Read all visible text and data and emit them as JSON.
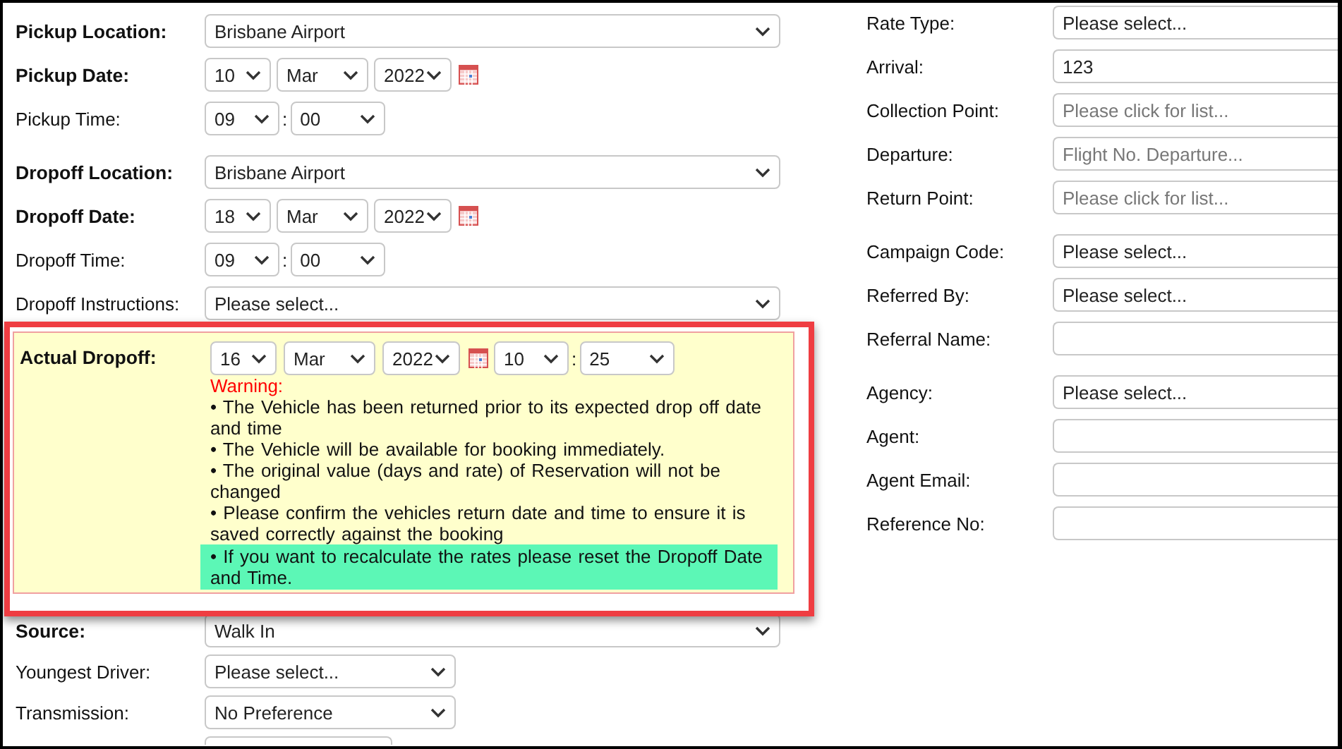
{
  "pickup_dropoff": {
    "groups": [
      [
        {
          "label": "Pickup Location:",
          "required": true,
          "kind": "select",
          "value": "Brisbane Airport"
        },
        {
          "label": "Pickup Date:",
          "required": true,
          "kind": "date",
          "day": "10",
          "month": "Mar",
          "year": "2022"
        },
        {
          "label": "Pickup Time:",
          "required": false,
          "kind": "time",
          "hour": "09",
          "separator": ":",
          "minute": "00"
        }
      ],
      [
        {
          "label": "Dropoff Location:",
          "required": true,
          "kind": "select",
          "value": "Brisbane Airport"
        },
        {
          "label": "Dropoff Date:",
          "required": true,
          "kind": "date",
          "day": "18",
          "month": "Mar",
          "year": "2022"
        },
        {
          "label": "Dropoff Time:",
          "required": false,
          "kind": "time",
          "hour": "09",
          "separator": ":",
          "minute": "00"
        },
        {
          "label": "Dropoff Instructions:",
          "required": false,
          "kind": "select",
          "value": "Please select..."
        }
      ]
    ]
  },
  "actual_dropoff": {
    "label": "Actual Dropoff:",
    "day": "16",
    "month": "Mar",
    "year": "2022",
    "hour": "10",
    "separator": ":",
    "minute": "25",
    "warning_title": "Warning:",
    "warnings": [
      {
        "text": "• The Vehicle has been returned prior to its expected drop off date and time",
        "highlighted": false
      },
      {
        "text": "• The Vehicle will be available for booking immediately.",
        "highlighted": false
      },
      {
        "text": "• The original value (days and rate) of Reservation will not be changed",
        "highlighted": false
      },
      {
        "text": "• Please confirm the vehicles return date and time to ensure it is saved correctly against the booking",
        "highlighted": false
      },
      {
        "text": "• If you want to recalculate the rates please reset the Dropoff Date and Time.",
        "highlighted": true
      }
    ]
  },
  "more_fields": [
    {
      "label": "Source:",
      "required": true,
      "kind": "select",
      "value": "Walk In"
    },
    {
      "label": "Youngest Driver:",
      "required": false,
      "kind": "short_select",
      "value": "Please select..."
    },
    {
      "label": "Transmission:",
      "required": false,
      "kind": "short_select",
      "value": "No Preference"
    },
    {
      "kind": "stub"
    }
  ],
  "right_form": {
    "groups": [
      [
        {
          "label": "Rate Type:",
          "kind": "select",
          "value": "Please select..."
        },
        {
          "label": "Arrival:",
          "kind": "input",
          "value": "123"
        },
        {
          "label": "Collection Point:",
          "kind": "input",
          "placeholder": "Please click for list..."
        },
        {
          "label": "Departure:",
          "kind": "input",
          "placeholder": "Flight No. Departure..."
        },
        {
          "label": "Return Point:",
          "kind": "input",
          "placeholder": "Please click for list..."
        }
      ],
      [
        {
          "label": "Campaign Code:",
          "kind": "select",
          "value": "Please select..."
        },
        {
          "label": "Referred By:",
          "kind": "select",
          "value": "Please select..."
        },
        {
          "label": "Referral Name:",
          "kind": "input"
        }
      ],
      [
        {
          "label": "Agency:",
          "kind": "select",
          "value": "Please select..."
        },
        {
          "label": "Agent:",
          "kind": "input"
        },
        {
          "label": "Agent Email:",
          "kind": "input"
        },
        {
          "label": "Reference No:",
          "kind": "input"
        }
      ]
    ]
  }
}
